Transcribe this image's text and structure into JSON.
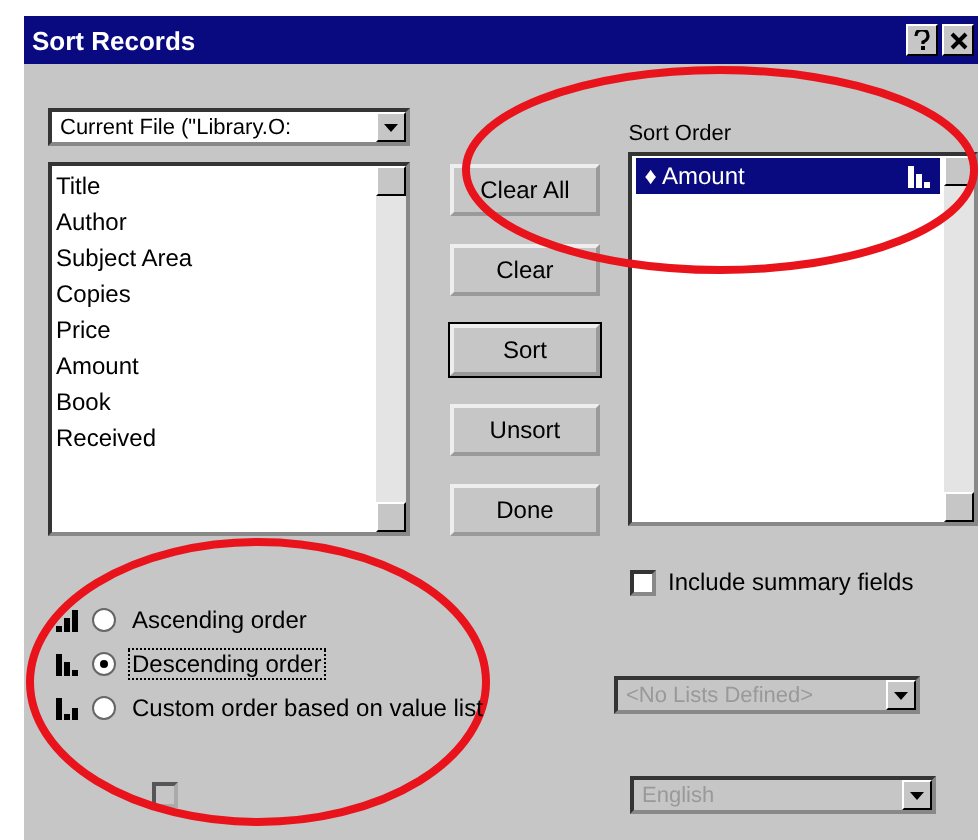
{
  "window": {
    "title": "Sort Records"
  },
  "file_dropdown": {
    "value": "Current File (\"Library.O:"
  },
  "fields": [
    "Title",
    "Author",
    "Subject Area",
    "Copies",
    "Price",
    "Amount",
    "Book",
    "Received"
  ],
  "buttons": [
    "Clear All",
    "Clear",
    "Sort",
    "Unsort",
    "Done"
  ],
  "sort_order": {
    "label": "Sort Order",
    "items": [
      {
        "marker": "♦",
        "label": "Amount",
        "kind": "descending",
        "selected": true
      }
    ]
  },
  "include_summary": {
    "label": "Include summary fields",
    "checked": false
  },
  "order_options": [
    {
      "kind": "ascending",
      "label": "Ascending order",
      "selected": false
    },
    {
      "kind": "descending",
      "label": "Descending order",
      "selected": true
    },
    {
      "kind": "custom",
      "label": "Custom order based on value list",
      "selected": false
    }
  ],
  "value_list_dropdown": {
    "value": "<No Lists Defined>",
    "disabled": true
  },
  "language": {
    "checked": false,
    "disabled": true,
    "dropdown": "English"
  },
  "annotations": [
    {
      "kind": "ellipse"
    },
    {
      "kind": "ellipse"
    }
  ]
}
